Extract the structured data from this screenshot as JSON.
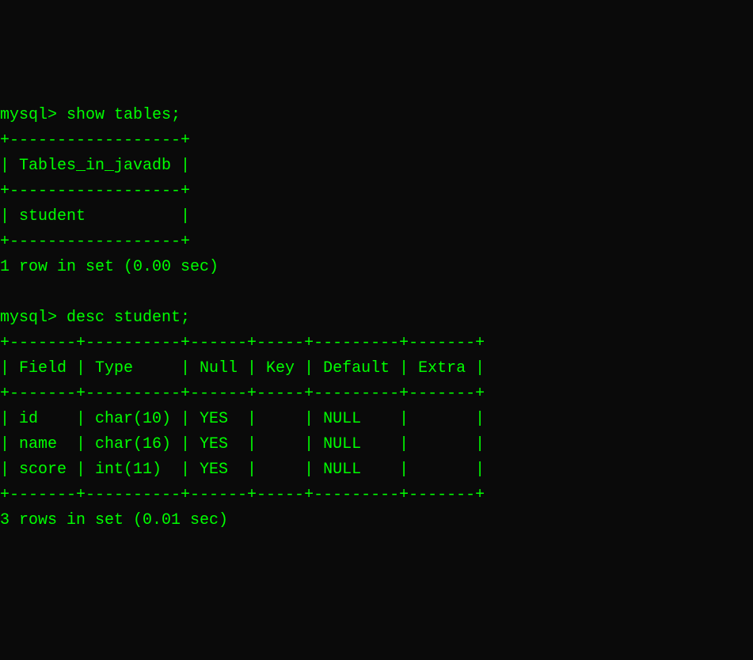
{
  "prompt": "mysql>",
  "commands": {
    "first": "show tables;",
    "second": "desc student;"
  },
  "table1": {
    "border_top": "+------------------+",
    "header_row": "| Tables_in_javadb |",
    "border_mid": "+------------------+",
    "data_row": "| student          |",
    "border_bottom": "+------------------+",
    "result": "1 row in set (0.00 sec)"
  },
  "table2": {
    "border_top": "+-------+----------+------+-----+---------+-------+",
    "header_row": "| Field | Type     | Null | Key | Default | Extra |",
    "border_mid": "+-------+----------+------+-----+---------+-------+",
    "row1": "| id    | char(10) | YES  |     | NULL    |       |",
    "row2": "| name  | char(16) | YES  |     | NULL    |       |",
    "row3": "| score | int(11)  | YES  |     | NULL    |       |",
    "border_bottom": "+-------+----------+------+-----+---------+-------+",
    "result": "3 rows in set (0.01 sec)"
  }
}
